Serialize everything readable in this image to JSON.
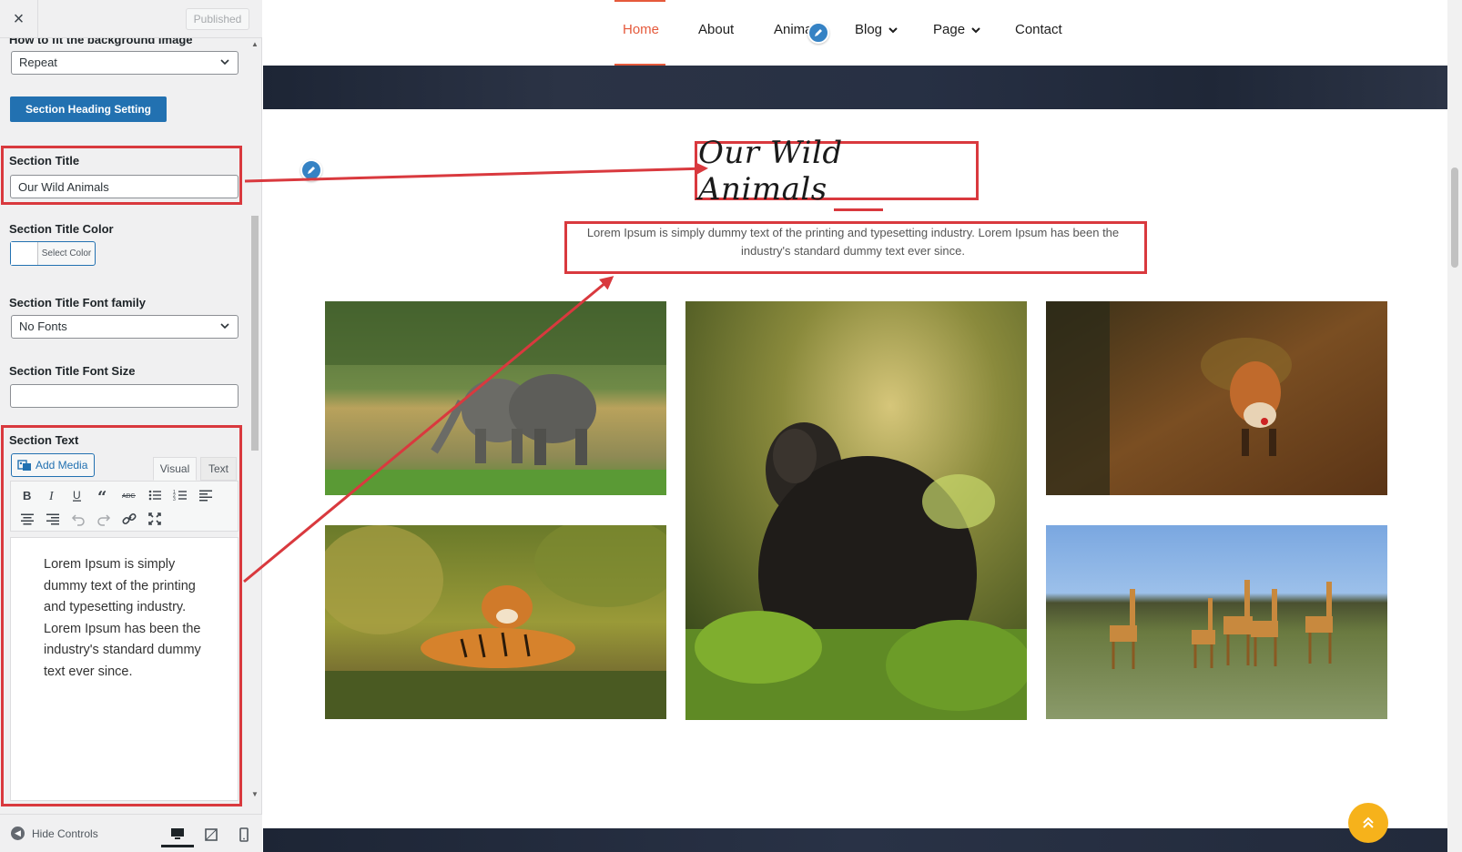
{
  "panel": {
    "close_label": "×",
    "publish_label": "Published",
    "fit_bg_label": "How to fit the background image",
    "fit_bg_value": "Repeat",
    "heading_btn": "Section Heading Setting",
    "title_label": "Section Title",
    "title_value": "Our Wild Animals",
    "title_color_label": "Section Title Color",
    "select_color": "Select Color",
    "font_family_label": "Section Title Font family",
    "font_family_value": "No Fonts",
    "font_size_label": "Section Title Font Size",
    "font_size_value": "",
    "text_label": "Section Text",
    "add_media": "Add Media",
    "tab_visual": "Visual",
    "tab_text": "Text",
    "editor_text": "Lorem Ipsum is simply dummy text of the printing and typesetting industry. Lorem Ipsum has been the industry's standard dummy text ever since.",
    "hide_controls": "Hide Controls",
    "accent_color": "#2271b1",
    "highlight_color": "#d9393e"
  },
  "preview": {
    "nav": {
      "home": "Home",
      "about": "About",
      "animals": "Anima",
      "blog": "Blog",
      "page": "Page",
      "contact": "Contact",
      "active_color": "#e55a3c"
    },
    "section_title": "Our Wild Animals",
    "section_text": "Lorem Ipsum is simply dummy text of the printing and typesetting industry. Lorem Ipsum has been the industry's standard dummy text ever since.",
    "photos": [
      "elephants",
      "gorilla",
      "fox",
      "tiger",
      "giraffes"
    ],
    "to_top_color": "#f6b21b"
  }
}
